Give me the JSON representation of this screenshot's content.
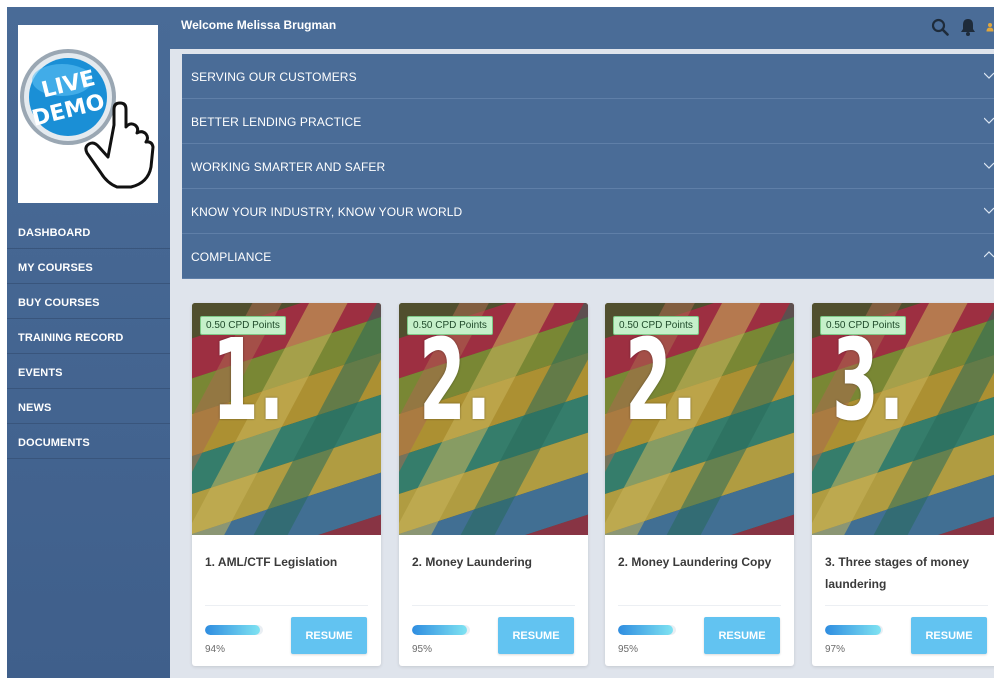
{
  "sidebar": {
    "logo_text": "LIVE DEMO",
    "items": [
      {
        "label": "DASHBOARD"
      },
      {
        "label": "MY COURSES"
      },
      {
        "label": "BUY COURSES"
      },
      {
        "label": "TRAINING RECORD"
      },
      {
        "label": "EVENTS"
      },
      {
        "label": "NEWS"
      },
      {
        "label": "DOCUMENTS"
      }
    ]
  },
  "header": {
    "welcome": "Welcome Melissa Brugman",
    "icons": [
      "search-icon",
      "bell-icon",
      "user-icon"
    ]
  },
  "accordion": {
    "sections": [
      {
        "label": "SERVING OUR CUSTOMERS",
        "expanded": false
      },
      {
        "label": "BETTER LENDING PRACTICE",
        "expanded": false
      },
      {
        "label": "WORKING SMARTER AND SAFER",
        "expanded": false
      },
      {
        "label": "KNOW YOUR INDUSTRY, KNOW YOUR WORLD",
        "expanded": false
      },
      {
        "label": "COMPLIANCE",
        "expanded": true
      }
    ]
  },
  "courses": [
    {
      "badge": "0.50 CPD Points",
      "number": "1.",
      "title": "1. AML/CTF Legislation",
      "progress": 94,
      "progress_label": "94%",
      "button": "RESUME"
    },
    {
      "badge": "0.50 CPD Points",
      "number": "2.",
      "title": "2. Money Laundering",
      "progress": 95,
      "progress_label": "95%",
      "button": "RESUME"
    },
    {
      "badge": "0.50 CPD Points",
      "number": "2.",
      "title": "2. Money Laundering Copy",
      "progress": 95,
      "progress_label": "95%",
      "button": "RESUME"
    },
    {
      "badge": "0.50 CPD Points",
      "number": "3.",
      "title": "3. Three stages of money laundering",
      "progress": 97,
      "progress_label": "97%",
      "button": "RESUME"
    }
  ],
  "colors": {
    "primary": "#4a6c97",
    "accent": "#62c3f1",
    "badge_bg": "#c5f0c9",
    "background": "#dfe4ec"
  }
}
